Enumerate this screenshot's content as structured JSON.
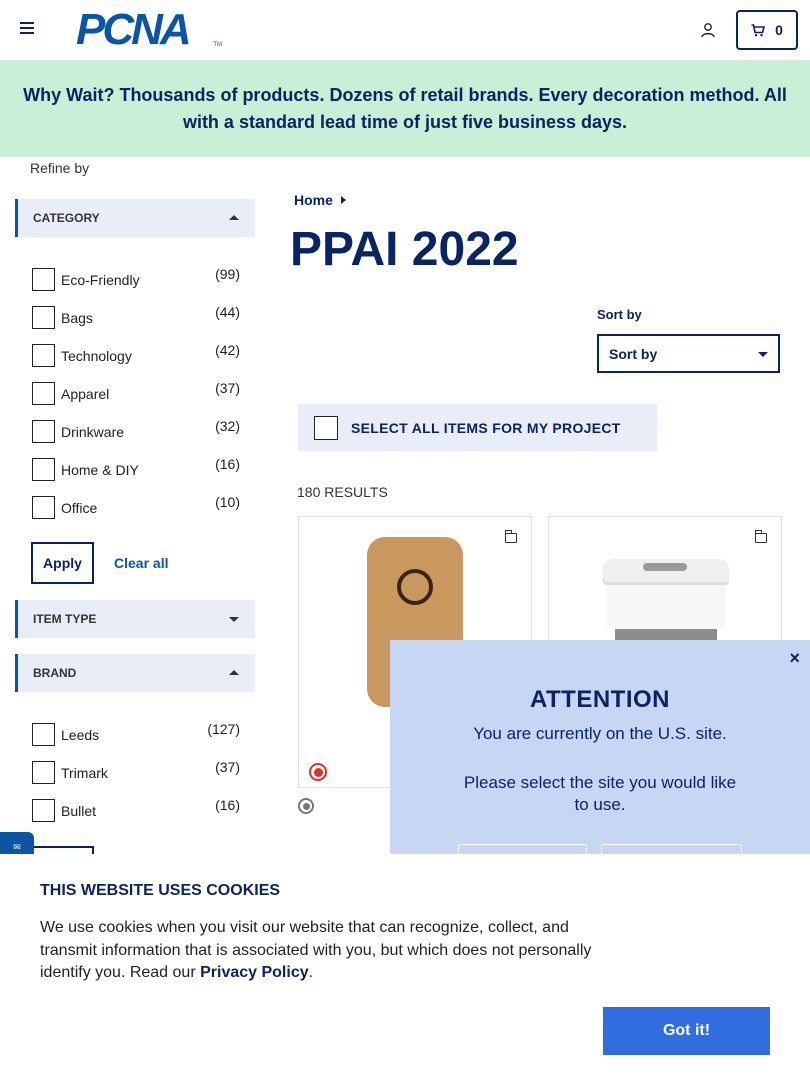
{
  "header": {
    "logo_text": "PCNA",
    "logo_tm": "TM",
    "cart_count": "0",
    "icons": {
      "menu": "hamburger-menu-icon",
      "user": "user-icon",
      "cart": "cart-icon"
    }
  },
  "banner": {
    "text": "Why Wait? Thousands of products. Dozens of retail brands. Every decoration method. All with a standard lead time of just five business days.",
    "background": "#c9f0d6"
  },
  "sidebar": {
    "refine_label": "Refine by",
    "category": {
      "title": "CATEGORY",
      "options": [
        {
          "label": "Eco-Friendly",
          "count": "(99)"
        },
        {
          "label": "Bags",
          "count": "(44)"
        },
        {
          "label": "Technology",
          "count": "(42)"
        },
        {
          "label": "Apparel",
          "count": "(37)"
        },
        {
          "label": "Drinkware",
          "count": "(32)"
        },
        {
          "label": "Home & DIY",
          "count": "(16)"
        },
        {
          "label": "Office",
          "count": "(10)"
        }
      ],
      "apply_label": "Apply",
      "clear_label": "Clear all"
    },
    "item_type": {
      "title": "ITEM TYPE"
    },
    "brand": {
      "title": "BRAND",
      "options": [
        {
          "label": "Leeds",
          "count": "(127)"
        },
        {
          "label": "Trimark",
          "count": "(37)"
        },
        {
          "label": "Bullet",
          "count": "(16)"
        }
      ]
    }
  },
  "main": {
    "breadcrumb": "Home",
    "title": "PPAI 2022",
    "sort_label": "Sort by",
    "sort_value": "Sort by",
    "select_all_label": "SELECT ALL ITEMS FOR MY PROJECT",
    "results": "180 RESULTS"
  },
  "popup": {
    "close": "×",
    "title": "ATTENTION",
    "line1": "You are currently on the U.S. site.",
    "line2": "Please select the site you would like to use."
  },
  "cookie": {
    "title": "THIS WEBSITE USES COOKIES",
    "text": "We use cookies when you visit our website that can recognize, collect, and transmit information that is associated with you, but which does not personally identify you. Read our ",
    "link": "Privacy Policy",
    "end": ".",
    "button": "Got it!",
    "button_color": "#2f6de1"
  },
  "colors": {
    "navy": "#0a2463",
    "brand_blue": "#0b56a4",
    "filter_bg": "#e9edf7",
    "popup_bg": "#c7d7f3"
  }
}
